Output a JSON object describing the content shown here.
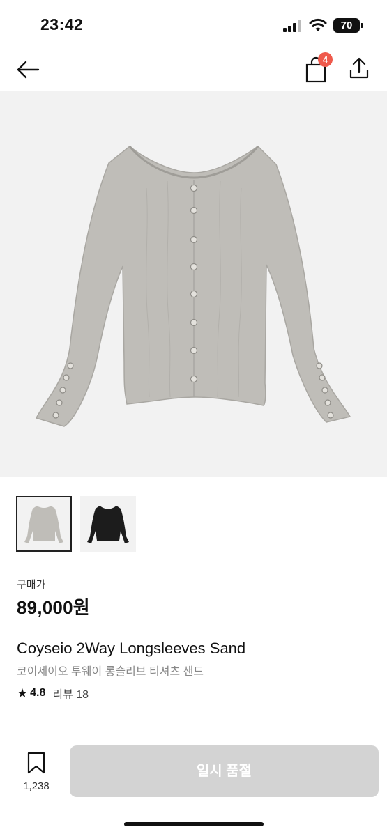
{
  "status_bar": {
    "time": "23:42",
    "battery": "70",
    "icons": [
      "signal-icon",
      "wifi-icon",
      "battery-icon"
    ]
  },
  "nav": {
    "back_icon": "arrow-left-icon",
    "bag_icon": "shopping-bag-icon",
    "bag_badge": "4",
    "share_icon": "share-icon",
    "badge_color": "#ef5a4c"
  },
  "product": {
    "price_label": "구매가",
    "price": "89,000원",
    "title_en": "Coyseio 2Way Longsleeves Sand",
    "title_ko": "코이세이오 투웨이 롱슬리브 티셔츠 샌드",
    "rating": "4.8",
    "review_text": "리뷰 18",
    "thumbnails": [
      {
        "color": "sand",
        "selected": true
      },
      {
        "color": "black",
        "selected": false
      }
    ]
  },
  "bottom_bar": {
    "bookmark_icon": "bookmark-icon",
    "bookmark_count": "1,238",
    "sold_out_label": "일시 품절",
    "sold_out_color": "#d3d3d3"
  }
}
